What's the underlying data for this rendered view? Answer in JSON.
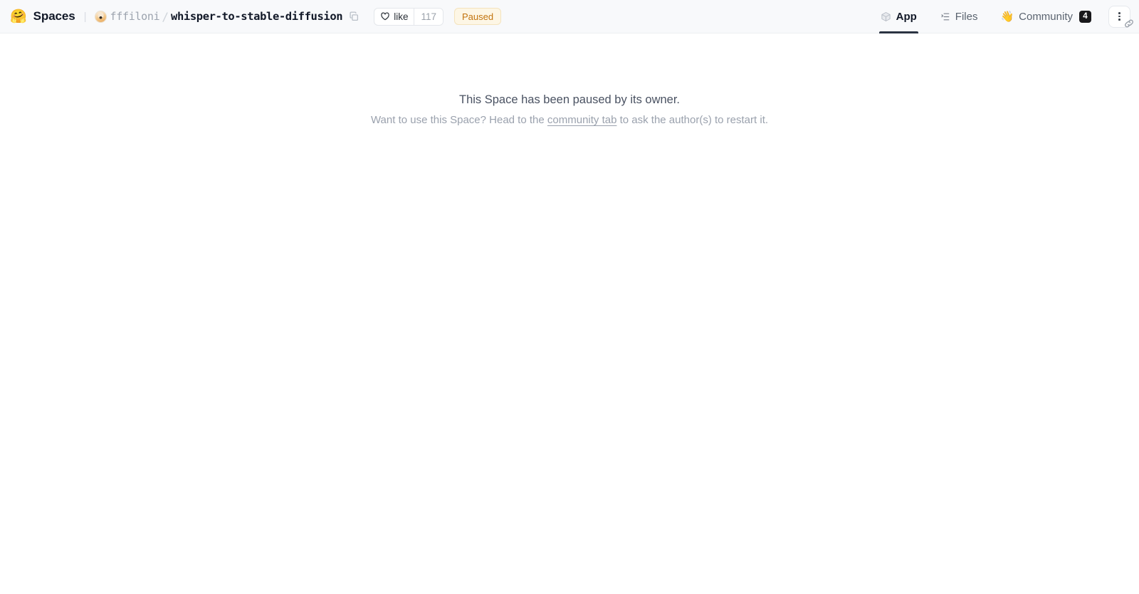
{
  "header": {
    "logo_icon": "hugging-face-emoji",
    "logo_glyph": "🤗",
    "product_label": "Spaces",
    "separator": "|",
    "owner": "fffiloni",
    "path_separator": "/",
    "repo_name": "whisper-to-stable-diffusion",
    "copy_icon": "copy-icon",
    "like": {
      "label": "like",
      "count": "117",
      "heart_icon": "heart-icon"
    },
    "status_badge": {
      "label": "Paused",
      "bg": "#fdf6e5",
      "border": "#f4e3bd",
      "text_color": "#c2740f"
    },
    "tabs": [
      {
        "label": "App",
        "icon": "cube-icon",
        "active": true,
        "badge": ""
      },
      {
        "label": "Files",
        "icon": "file-list-icon",
        "active": false,
        "badge": ""
      },
      {
        "label": "Community",
        "icon": "wave-hand-emoji",
        "emoji": "👋",
        "active": false,
        "badge": "4"
      }
    ],
    "overflow": {
      "icon": "vertical-dots-icon",
      "secondary_icon": "link-icon"
    }
  },
  "main": {
    "title": "This Space has been paused by its owner.",
    "subtitle_prefix": "Want to use this Space? Head to the ",
    "link_label": "community tab",
    "subtitle_suffix": " to ask the author(s) to restart it."
  },
  "colors": {
    "header_bg": "#f8f9fb",
    "body_bg": "#ffffff",
    "accent_dark": "#2b3342",
    "badge_dark": "#18181b"
  }
}
